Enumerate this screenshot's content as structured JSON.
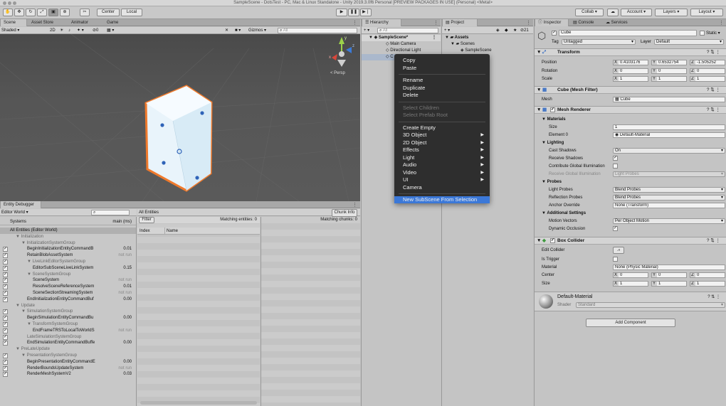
{
  "window": {
    "title": "SampleScene - DotsTest - PC, Mac & Linux Standalone - Unity 2019.3.0f6 Personal [PREVIEW PACKAGES IN USE] (Personal) <Metal>"
  },
  "toolbar": {
    "center_label": "Center",
    "local_label": "Local",
    "collab_label": "Collab ▾",
    "account_label": "Account ▾",
    "layers_label": "Layers",
    "layout_label": "Layout"
  },
  "scene_panel": {
    "tabs": [
      "Scene",
      "Asset Store",
      "Animator",
      "Game"
    ],
    "shading_mode": "Shaded",
    "mode_2d": "2D",
    "hidden_count": "0",
    "gizmos_label": "Gizmos",
    "search_placeholder": "All",
    "persp_label": "< Persp",
    "axis_y": "y",
    "axis_z": "z",
    "axis_x": "x"
  },
  "entity_debugger": {
    "tab": "Entity Debugger",
    "world": "Editor World",
    "systems_header": "Systems",
    "time_header": "main (ms)",
    "all_entities_tab": "All Entities",
    "filter_label": "Filter",
    "chunk_info_label": "Chunk Info",
    "matching_entities": "Matching entities: 0",
    "matching_chunks": "Matching chunks: 0",
    "columns": [
      "Index",
      "Name"
    ],
    "systems": [
      {
        "name": "All Entities (Editor World)",
        "indent": 0,
        "value": "",
        "check": false,
        "group": false,
        "sel": true
      },
      {
        "name": "▼ Initialization",
        "indent": 1,
        "value": "",
        "check": false,
        "group": true
      },
      {
        "name": "▼ InitializationSystemGroup",
        "indent": 2,
        "value": "",
        "check": false,
        "group": true
      },
      {
        "name": "BeginInitializationEntityCommandB",
        "indent": 3,
        "value": "0.01",
        "check": true,
        "group": false
      },
      {
        "name": "RetainBlobAssetSystem",
        "indent": 3,
        "value": "not run",
        "check": true,
        "group": false,
        "dim": true
      },
      {
        "name": "▼ LiveLinkEditorSystemGroup",
        "indent": 3,
        "value": "",
        "check": true,
        "group": true
      },
      {
        "name": "EditorSubSceneLiveLinkSystem",
        "indent": 4,
        "value": "0.15",
        "check": true,
        "group": false
      },
      {
        "name": "▼ SceneSystemGroup",
        "indent": 3,
        "value": "",
        "check": true,
        "group": true
      },
      {
        "name": "SceneSystem",
        "indent": 4,
        "value": "not run",
        "check": true,
        "group": false,
        "dim": true
      },
      {
        "name": "ResolveSceneReferenceSystem",
        "indent": 4,
        "value": "0.01",
        "check": true,
        "group": false
      },
      {
        "name": "SceneSectionStreamingSystem",
        "indent": 4,
        "value": "not run",
        "check": true,
        "group": false,
        "dim": true
      },
      {
        "name": "EndInitializationEntityCommandBuf",
        "indent": 3,
        "value": "0.00",
        "check": true,
        "group": false
      },
      {
        "name": "▼ Update",
        "indent": 1,
        "value": "",
        "check": false,
        "group": true
      },
      {
        "name": "▼ SimulationSystemGroup",
        "indent": 2,
        "value": "",
        "check": true,
        "group": true
      },
      {
        "name": "BeginSimulationEntityCommandBu",
        "indent": 3,
        "value": "0.00",
        "check": true,
        "group": false
      },
      {
        "name": "▼ TransformSystemGroup",
        "indent": 3,
        "value": "",
        "check": true,
        "group": true
      },
      {
        "name": "EndFrameTRSToLocalToWorldS",
        "indent": 4,
        "value": "not run",
        "check": true,
        "group": false,
        "dim": true
      },
      {
        "name": "LateSimulationSystemGroup",
        "indent": 3,
        "value": "",
        "check": true,
        "group": true
      },
      {
        "name": "EndSimulationEntityCommandBuffe",
        "indent": 3,
        "value": "0.00",
        "check": true,
        "group": false
      },
      {
        "name": "▼ PreLateUpdate",
        "indent": 1,
        "value": "",
        "check": false,
        "group": true
      },
      {
        "name": "▼ PresentationSystemGroup",
        "indent": 2,
        "value": "",
        "check": true,
        "group": true
      },
      {
        "name": "BeginPresentationEntityCommandE",
        "indent": 3,
        "value": "0.00",
        "check": true,
        "group": false
      },
      {
        "name": "RenderBoundsUpdateSystem",
        "indent": 3,
        "value": "not run",
        "check": true,
        "group": false,
        "dim": true
      },
      {
        "name": "RenderMeshSystemV2",
        "indent": 3,
        "value": "0.03",
        "check": true,
        "group": false
      }
    ]
  },
  "hierarchy": {
    "tab": "Hierarchy",
    "add_label": "+ ▾",
    "search_placeholder": "All",
    "scene": "SampleScene*",
    "items": [
      "Main Camera",
      "Directional Light",
      "C"
    ]
  },
  "project": {
    "tab": "Project",
    "count": "21",
    "assets": "Assets",
    "scenes": "Scenes",
    "sample_scene": "SampleScene"
  },
  "context_menu": {
    "items": [
      {
        "label": "Copy",
        "enabled": true
      },
      {
        "label": "Paste",
        "enabled": true
      },
      {
        "sep": true
      },
      {
        "label": "Rename",
        "enabled": true
      },
      {
        "label": "Duplicate",
        "enabled": true
      },
      {
        "label": "Delete",
        "enabled": true
      },
      {
        "sep": true
      },
      {
        "label": "Select Children",
        "enabled": false
      },
      {
        "label": "Select Prefab Root",
        "enabled": false
      },
      {
        "sep": true
      },
      {
        "label": "Create Empty",
        "enabled": true
      },
      {
        "label": "3D Object",
        "enabled": true,
        "submenu": true
      },
      {
        "label": "2D Object",
        "enabled": true,
        "submenu": true
      },
      {
        "label": "Effects",
        "enabled": true,
        "submenu": true
      },
      {
        "label": "Light",
        "enabled": true,
        "submenu": true
      },
      {
        "label": "Audio",
        "enabled": true,
        "submenu": true
      },
      {
        "label": "Video",
        "enabled": true,
        "submenu": true
      },
      {
        "label": "UI",
        "enabled": true,
        "submenu": true
      },
      {
        "label": "Camera",
        "enabled": true
      },
      {
        "sep": true
      },
      {
        "label": "New SubScene From Selection",
        "enabled": true,
        "highlight": true
      }
    ]
  },
  "inspector": {
    "tabs": [
      "Inspector",
      "Console",
      "Services"
    ],
    "object_name": "Cube",
    "static_label": "Static ▾",
    "tag_label": "Tag",
    "tag_value": "Untagged",
    "layer_label": "Layer",
    "layer_value": "Default",
    "transform": {
      "title": "Transform",
      "position_label": "Position",
      "position": [
        "0.4103176",
        "0.6532754",
        "-1.505252"
      ],
      "rotation_label": "Rotation",
      "rotation": [
        "0",
        "0",
        "0"
      ],
      "scale_label": "Scale",
      "scale": [
        "1",
        "1",
        "1"
      ]
    },
    "mesh_filter": {
      "title": "Cube (Mesh Filter)",
      "mesh_label": "Mesh",
      "mesh_value": "Cube"
    },
    "mesh_renderer": {
      "title": "Mesh Renderer",
      "materials": "Materials",
      "size_label": "Size",
      "size_value": "1",
      "element_label": "Element 0",
      "element_value": "Default-Material",
      "lighting": "Lighting",
      "cast_shadows_label": "Cast Shadows",
      "cast_shadows_value": "On",
      "receive_shadows_label": "Receive Shadows",
      "contribute_gi_label": "Contribute Global Illumination",
      "receive_gi_label": "Receive Global Illumination",
      "receive_gi_value": "Light Probes",
      "probes": "Probes",
      "light_probes_label": "Light Probes",
      "light_probes_value": "Blend Probes",
      "reflection_probes_label": "Reflection Probes",
      "reflection_probes_value": "Blend Probes",
      "anchor_label": "Anchor Override",
      "anchor_value": "None (Transform)",
      "additional": "Additional Settings",
      "motion_label": "Motion Vectors",
      "motion_value": "Per Object Motion",
      "dynamic_label": "Dynamic Occlusion"
    },
    "box_collider": {
      "title": "Box Collider",
      "edit_label": "Edit Collider",
      "trigger_label": "Is Trigger",
      "material_label": "Material",
      "material_value": "None (Physic Material)",
      "center_label": "Center",
      "center": [
        "0",
        "0",
        "0"
      ],
      "size_label": "Size",
      "size": [
        "1",
        "1",
        "1"
      ]
    },
    "material": {
      "name": "Default-Material",
      "shader_label": "Shader",
      "shader_value": "Standard"
    },
    "add_component": "Add Component"
  }
}
